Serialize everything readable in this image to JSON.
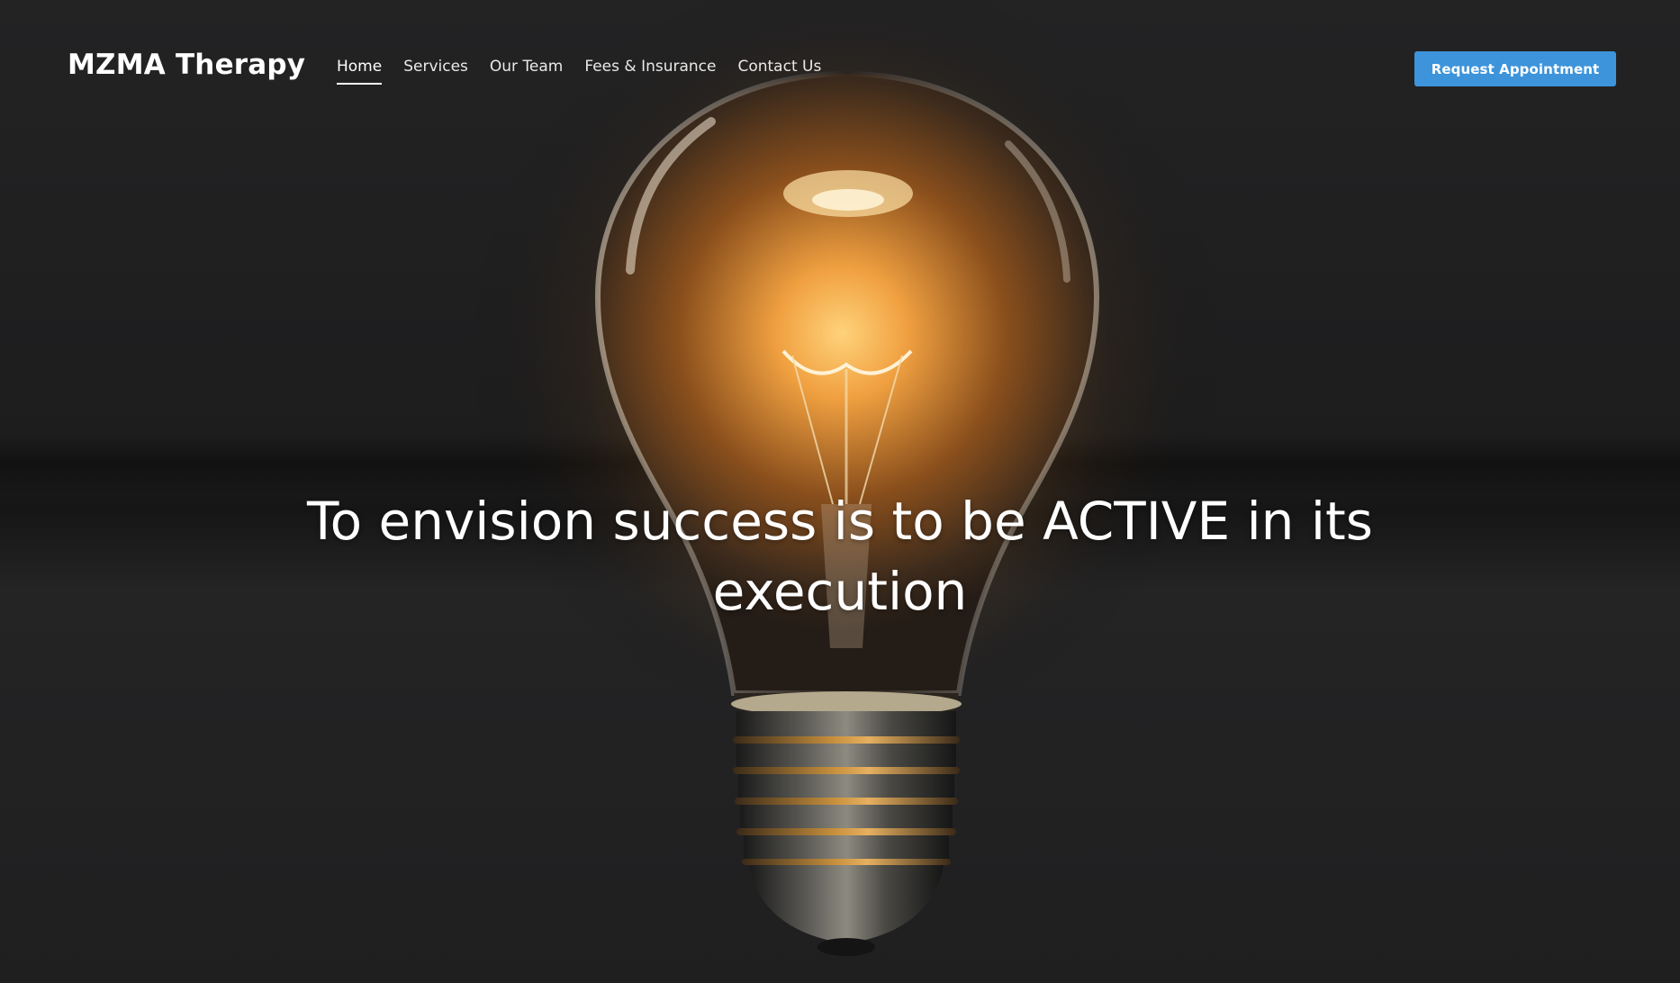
{
  "brand": {
    "name": "MZMA Therapy"
  },
  "nav": {
    "items": [
      {
        "label": "Home",
        "active": true
      },
      {
        "label": "Services",
        "active": false
      },
      {
        "label": "Our Team",
        "active": false
      },
      {
        "label": "Fees & Insurance",
        "active": false
      },
      {
        "label": "Contact Us",
        "active": false
      }
    ]
  },
  "cta": {
    "label": "Request Appointment",
    "color": "#3d94db"
  },
  "hero": {
    "headline": "To envision success is to be ACTIVE in its execution",
    "background_image": "light-bulb-icon"
  }
}
